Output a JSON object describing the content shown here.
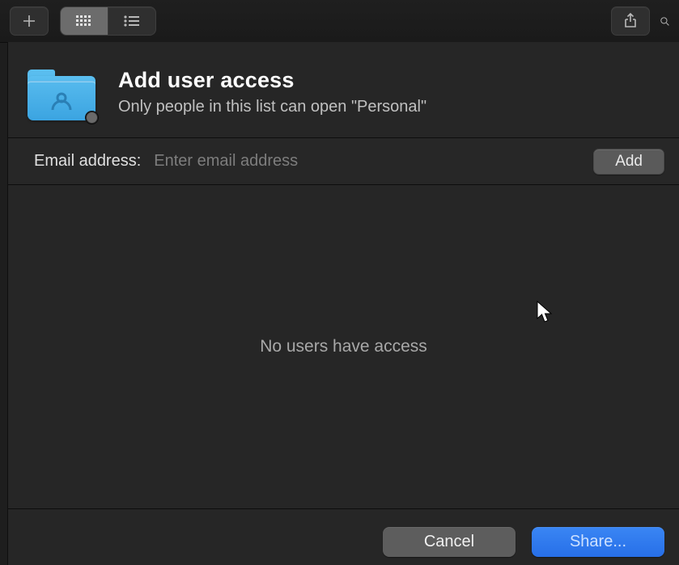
{
  "dialog": {
    "title": "Add user access",
    "subtitle": "Only people in this list can open \"Personal\""
  },
  "email": {
    "label": "Email address:",
    "placeholder": "Enter email address",
    "value": "",
    "add_label": "Add"
  },
  "users": {
    "empty_message": "No users have access"
  },
  "footer": {
    "cancel_label": "Cancel",
    "share_label": "Share..."
  }
}
